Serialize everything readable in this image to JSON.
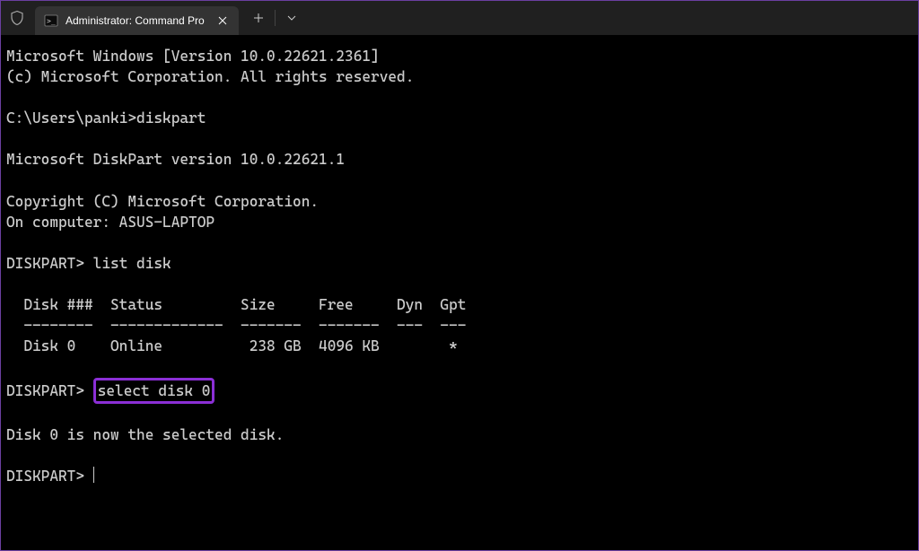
{
  "titlebar": {
    "tab_title": "Administrator: Command Pro",
    "new_tab_label": "+",
    "dropdown_label": "⌄"
  },
  "terminal": {
    "line1": "Microsoft Windows [Version 10.0.22621.2361]",
    "line2": "(c) Microsoft Corporation. All rights reserved.",
    "prompt1_path": "C:\\Users\\panki>",
    "prompt1_cmd": "diskpart",
    "diskpart_version": "Microsoft DiskPart version 10.0.22621.1",
    "copyright": "Copyright (C) Microsoft Corporation.",
    "computer": "On computer: ASUS-LAPTOP",
    "dp_prompt": "DISKPART>",
    "cmd_list": " list disk",
    "table_header": "  Disk ###  Status         Size     Free     Dyn  Gpt",
    "table_divider": "  --------  -------------  -------  -------  ---  ---",
    "table_row1": "  Disk 0    Online          238 GB  4096 KB        *",
    "cmd_select": "select disk 0",
    "result": "Disk 0 is now the selected disk.",
    "final_prompt": "DISKPART> "
  }
}
